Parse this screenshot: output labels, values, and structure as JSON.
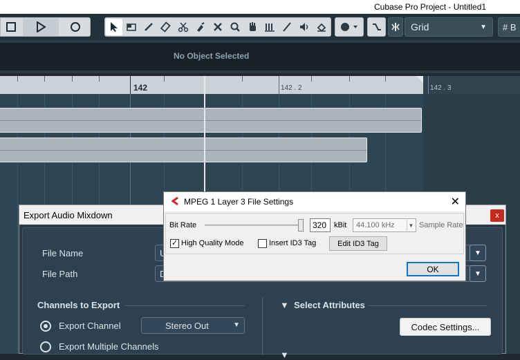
{
  "window": {
    "title": "Cubase Pro Project - Untitled1"
  },
  "toolbar": {
    "grid_label": "Grid",
    "hash_label": "B"
  },
  "info_line": {
    "message": "No Object Selected"
  },
  "ruler": {
    "bar_label": "142",
    "sub_label_1": "142 . 2",
    "sub_label_2": "142 . 3"
  },
  "export_dialog": {
    "title": "Export Audio Mixdown",
    "close_label": "x",
    "file_name_label": "File Name",
    "file_name_value": "U",
    "file_path_label": "File Path",
    "file_path_value": "D",
    "channels_heading": "Channels to Export",
    "export_channel_label": "Export Channel",
    "export_channel_value": "Stereo Out",
    "export_multiple_label": "Export Multiple Channels",
    "select_attributes_label": "Select Attributes",
    "codec_settings_label": "Codec Settings..."
  },
  "mpeg_dialog": {
    "title": "MPEG 1 Layer 3 File Settings",
    "bit_rate_label": "Bit Rate",
    "bit_rate_value": "320",
    "bit_rate_unit": "kBit",
    "sample_rate_value": "44.100 kHz",
    "sample_rate_label": "Sample Rate",
    "high_quality_label": "High Quality Mode",
    "high_quality_checked": true,
    "insert_id3_label": "Insert ID3 Tag",
    "insert_id3_checked": false,
    "edit_id3_label": "Edit ID3 Tag",
    "ok_label": "OK"
  },
  "colors": {
    "accent_blue": "#0078d7",
    "close_red": "#c42b1c",
    "cubase_logo": "#cc2a2a"
  }
}
